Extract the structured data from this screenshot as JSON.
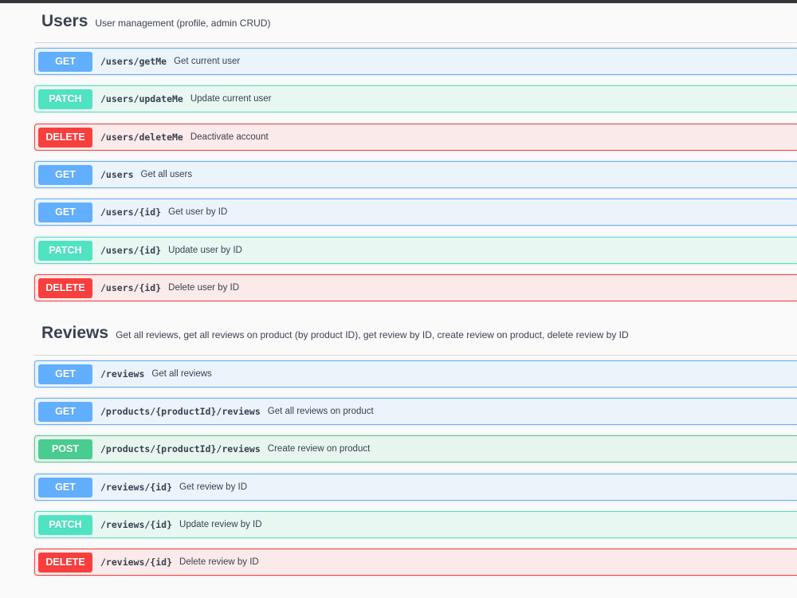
{
  "sections": [
    {
      "title": "Users",
      "description": "User management (profile, admin CRUD)",
      "operations": [
        {
          "method": "GET",
          "path": "/users/getMe",
          "summary": "Get current user"
        },
        {
          "method": "PATCH",
          "path": "/users/updateMe",
          "summary": "Update current user"
        },
        {
          "method": "DELETE",
          "path": "/users/deleteMe",
          "summary": "Deactivate account"
        },
        {
          "method": "GET",
          "path": "/users",
          "summary": "Get all users"
        },
        {
          "method": "GET",
          "path": "/users/{id}",
          "summary": "Get user by ID"
        },
        {
          "method": "PATCH",
          "path": "/users/{id}",
          "summary": "Update user by ID"
        },
        {
          "method": "DELETE",
          "path": "/users/{id}",
          "summary": "Delete user by ID"
        }
      ]
    },
    {
      "title": "Reviews",
      "description": "Get all reviews, get all reviews on product (by product ID), get review by ID, create review on product, delete review by ID",
      "operations": [
        {
          "method": "GET",
          "path": "/reviews",
          "summary": "Get all reviews"
        },
        {
          "method": "GET",
          "path": "/products/{productId}/reviews",
          "summary": "Get all reviews on product"
        },
        {
          "method": "POST",
          "path": "/products/{productId}/reviews",
          "summary": "Create review on product"
        },
        {
          "method": "GET",
          "path": "/reviews/{id}",
          "summary": "Get review by ID"
        },
        {
          "method": "PATCH",
          "path": "/reviews/{id}",
          "summary": "Update review by ID"
        },
        {
          "method": "DELETE",
          "path": "/reviews/{id}",
          "summary": "Delete review by ID"
        }
      ]
    }
  ],
  "colors": {
    "get": "#61affe",
    "patch": "#50e3c2",
    "delete": "#f93e3e",
    "post": "#49cc90"
  }
}
